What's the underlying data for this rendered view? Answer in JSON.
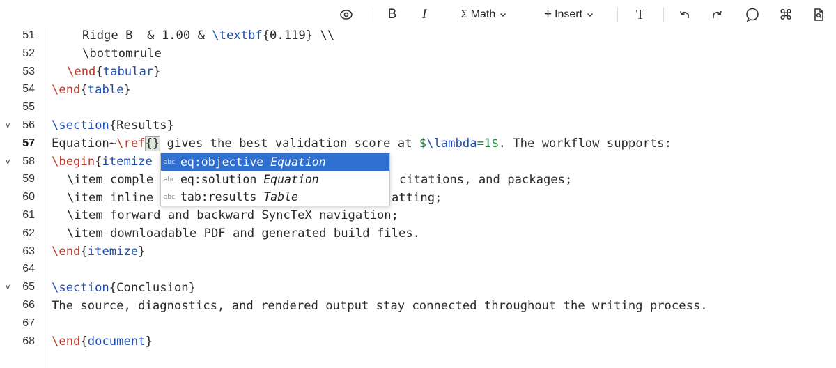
{
  "toolbar": {
    "bold": "B",
    "italic": "I",
    "math": "Math",
    "insert": "Insert",
    "text_format": "T"
  },
  "lines": [
    {
      "num": "51"
    },
    {
      "num": "52"
    },
    {
      "num": "53"
    },
    {
      "num": "54"
    },
    {
      "num": "55"
    },
    {
      "num": "56",
      "fold": "v"
    },
    {
      "num": "57"
    },
    {
      "num": "58",
      "fold": "v"
    },
    {
      "num": "59"
    },
    {
      "num": "60"
    },
    {
      "num": "61"
    },
    {
      "num": "62"
    },
    {
      "num": "63"
    },
    {
      "num": "64"
    },
    {
      "num": "65",
      "fold": "v"
    },
    {
      "num": "66"
    },
    {
      "num": "67"
    },
    {
      "num": "68"
    }
  ],
  "code": {
    "l51_a": "Ridge B  & 1.00 & ",
    "l51_cmd": "\\textbf",
    "l51_b": "{0.119} \\\\",
    "l52": "\\bottomrule",
    "l53_cmd": "\\end",
    "l53_env": "tabular",
    "l54_cmd": "\\end",
    "l54_env": "table",
    "l56_cmd": "\\section",
    "l56_arg": "Results",
    "l57_a": "Equation~",
    "l57_cmd": "\\ref",
    "l57_b": " gives the best validation score at ",
    "l57_math1": "$",
    "l57_mcmd": "\\lambda",
    "l57_math2": "=1$",
    "l57_c": ". The workflow supports:",
    "l58_cmd": "\\begin",
    "l58_env": "itemize",
    "l59_a": "\\item comple",
    "l59_b": "citations, and packages;",
    "l60_a": "\\item inline",
    "l60_b": "atting;",
    "l61": "\\item forward and backward SyncTeX navigation;",
    "l62": "\\item downloadable PDF and generated build files.",
    "l63_cmd": "\\end",
    "l63_env": "itemize",
    "l65_cmd": "\\section",
    "l65_arg": "Conclusion",
    "l66": "The source, diagnostics, and rendered output stay connected throughout the writing process.",
    "l68_cmd": "\\end",
    "l68_env": "document"
  },
  "autocomplete": {
    "badge": "abc",
    "items": [
      {
        "label": "eq:objective",
        "type": "Equation"
      },
      {
        "label": "eq:solution",
        "type": "Equation"
      },
      {
        "label": "tab:results",
        "type": "Table"
      }
    ]
  }
}
